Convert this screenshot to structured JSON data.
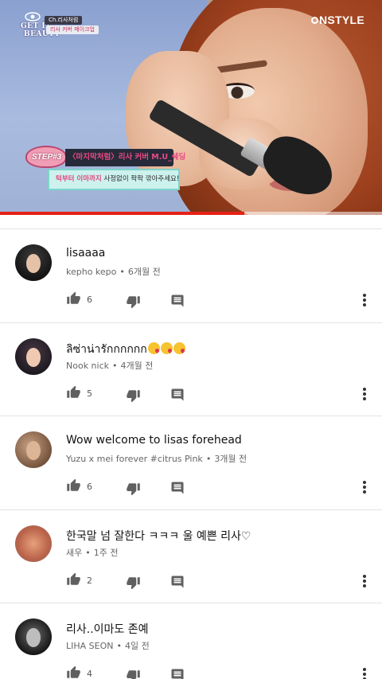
{
  "video": {
    "channel_logo_line1": "GET IT",
    "channel_logo_line2": "BEAUTY",
    "chapter_tag": "Ch.리사처럼",
    "chapter_sub": "리사 커버 메이크업",
    "brand": "NSTYLE",
    "step_tag": "STEP#3",
    "step_title": "〈마지막처럼〉리사 커버 M.U_쉐딩",
    "step_sub_highlight": "턱부터 이마까지",
    "step_sub_rest": " 사정없이 팍팍 깎아주세요!",
    "progress_fraction": 0.64,
    "progress_color": "#e62117"
  },
  "comments": [
    {
      "text": "lisaaaa",
      "author": "kepho kepo",
      "time": "6개월 전",
      "likes": "6",
      "avatar": "avatar-dark-hair"
    },
    {
      "text": "ลิซ่าน่ารักกกกกก",
      "emoji_count": 3,
      "author": "Nook nick",
      "time": "4개월 전",
      "likes": "5",
      "avatar": "avatar-long-hair"
    },
    {
      "text": "Wow welcome to lisas forehead",
      "author": "Yuzu x mei forever #citrus Pink",
      "time": "3개월 전",
      "likes": "6",
      "avatar": "avatar-brown-photo"
    },
    {
      "text": "한국말 넘 잘한다 ㅋㅋㅋ 울 예쁜 리사♡",
      "author": "새우",
      "time": "1주 전",
      "likes": "2",
      "avatar": "avatar-shrimp"
    },
    {
      "text": "리사..이마도 존예",
      "author": "LIHA SEON",
      "time": "4일 전",
      "likes": "4",
      "avatar": "avatar-bw-portrait"
    }
  ],
  "icons": {
    "like": "thumbs-up-icon",
    "dislike": "thumbs-down-icon",
    "reply": "reply-comment-icon",
    "more": "more-vertical-icon"
  },
  "colors": {
    "text_primary": "#111111",
    "text_secondary": "#666666",
    "icon_gray": "#606060",
    "divider": "#e3e3e3"
  }
}
